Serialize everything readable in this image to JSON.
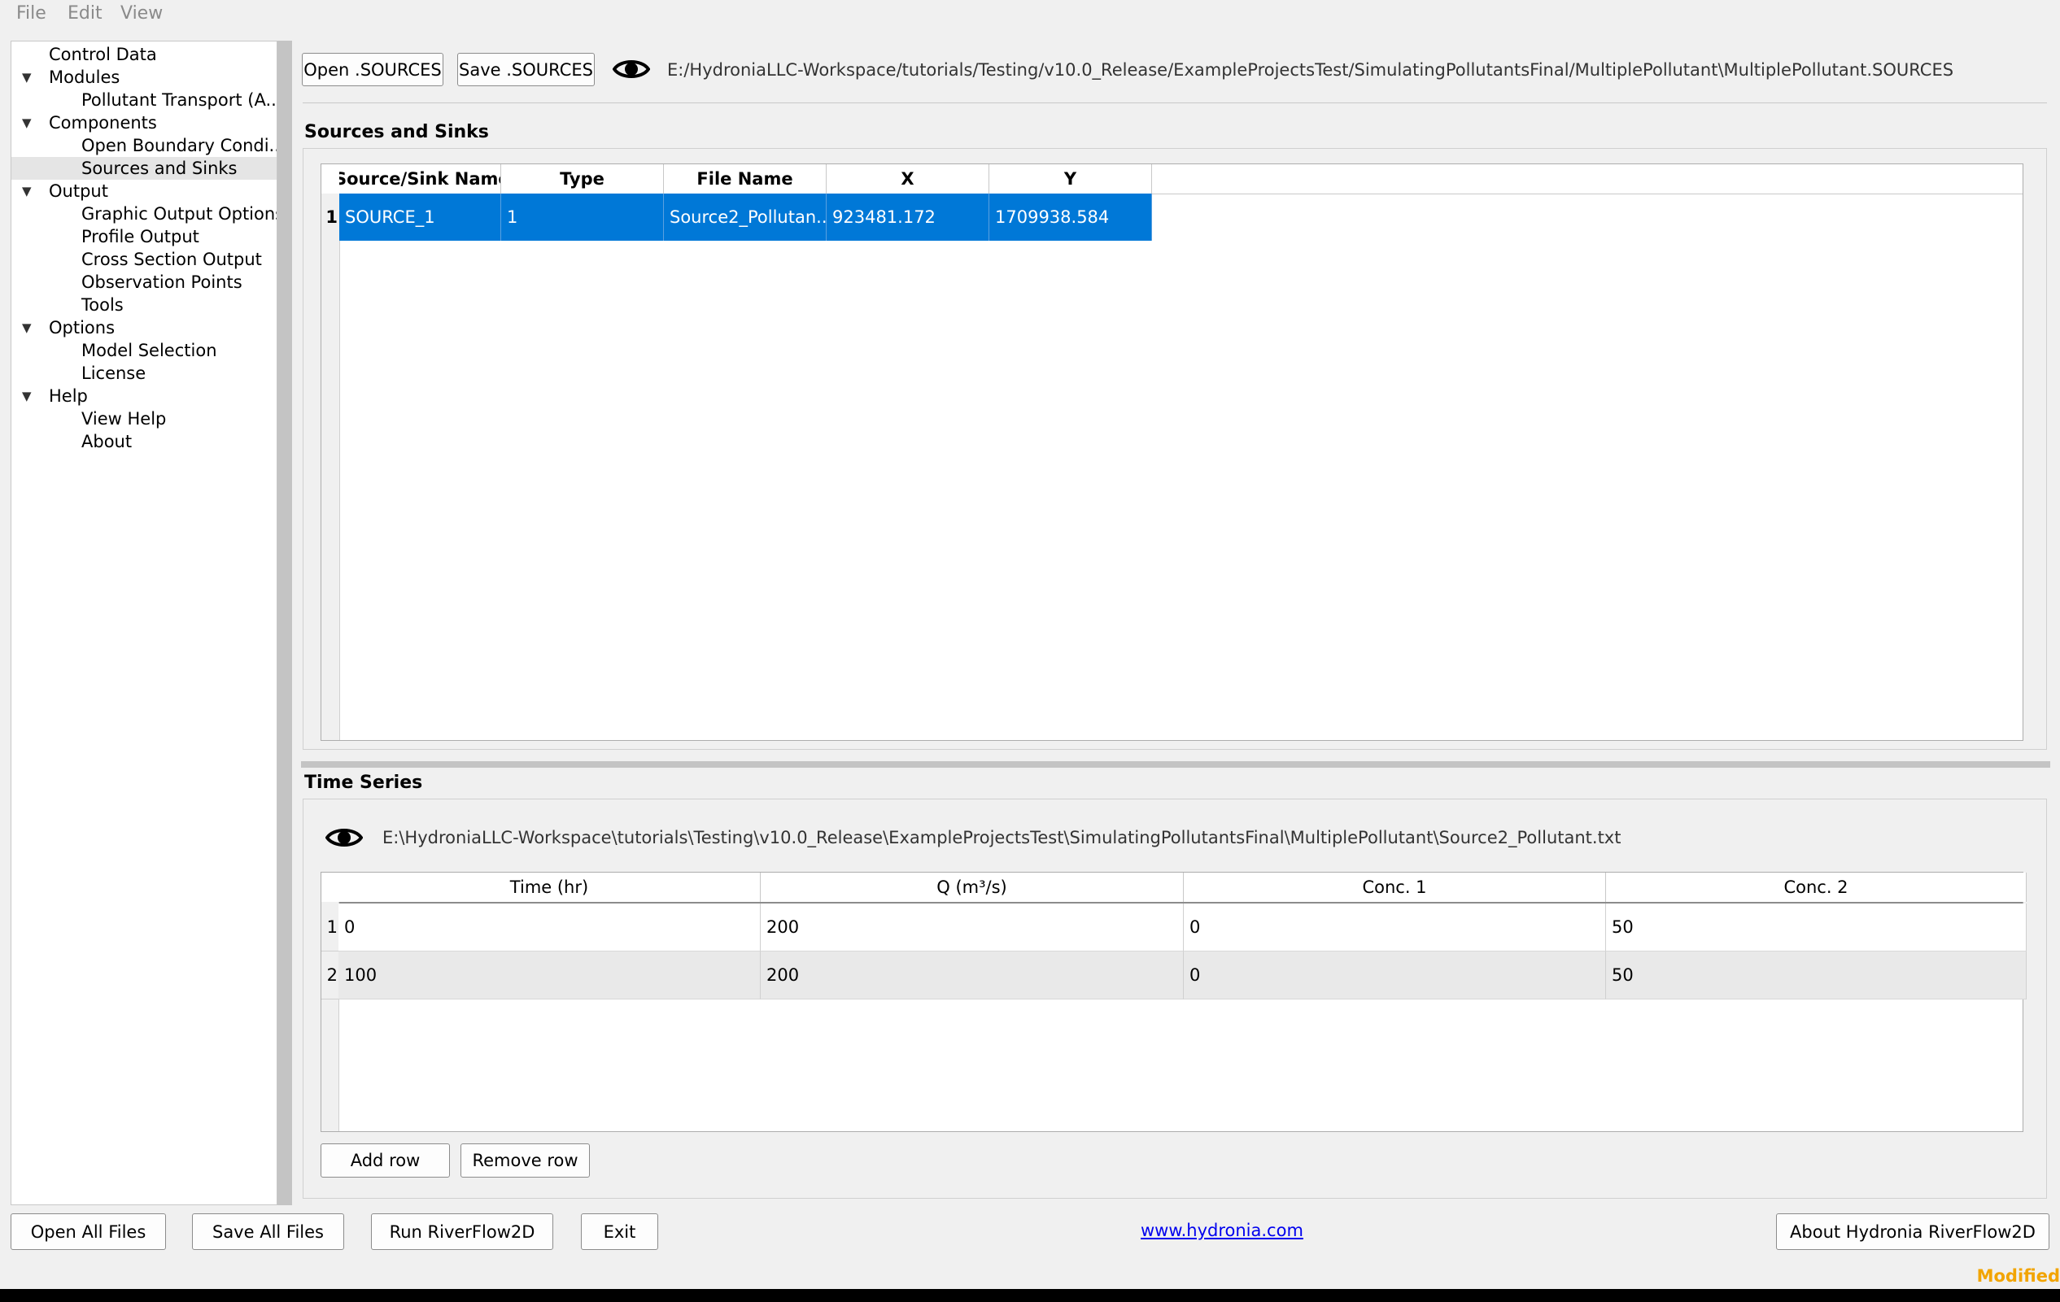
{
  "menu": {
    "file": "File",
    "edit": "Edit",
    "view": "View"
  },
  "tree": {
    "items": [
      {
        "label": "Control Data",
        "level": 0,
        "expander": false
      },
      {
        "label": "Modules",
        "level": 0,
        "expander": true
      },
      {
        "label": "Pollutant Transport (A...",
        "level": 1,
        "expander": false
      },
      {
        "label": "Components",
        "level": 0,
        "expander": true
      },
      {
        "label": "Open Boundary Condi...",
        "level": 1,
        "expander": false
      },
      {
        "label": "Sources and Sinks",
        "level": 1,
        "expander": false,
        "selected": true
      },
      {
        "label": "Output",
        "level": 0,
        "expander": true
      },
      {
        "label": "Graphic Output Options",
        "level": 1,
        "expander": false
      },
      {
        "label": "Profile Output",
        "level": 1,
        "expander": false
      },
      {
        "label": "Cross Section Output",
        "level": 1,
        "expander": false
      },
      {
        "label": "Observation Points",
        "level": 1,
        "expander": false
      },
      {
        "label": "Tools",
        "level": 1,
        "expander": false
      },
      {
        "label": "Options",
        "level": 0,
        "expander": true
      },
      {
        "label": "Model Selection",
        "level": 1,
        "expander": false
      },
      {
        "label": "License",
        "level": 1,
        "expander": false
      },
      {
        "label": "Help",
        "level": 0,
        "expander": true
      },
      {
        "label": "View Help",
        "level": 1,
        "expander": false
      },
      {
        "label": "About",
        "level": 1,
        "expander": false
      }
    ],
    "expander_icon": "triangle-down-icon"
  },
  "toolbar": {
    "open_label": "Open .SOURCES",
    "save_label": "Save .SOURCES",
    "eye_icon": "eye-icon",
    "path": "E:/HydroniaLLC-Workspace/tutorials/Testing/v10.0_Release/ExampleProjectsTest/SimulatingPollutantsFinal/MultiplePollutant\\MultiplePollutant.SOURCES"
  },
  "sources": {
    "title": "Sources and Sinks",
    "columns": [
      "Source/Sink Name",
      "Type",
      "File Name",
      "X",
      "Y"
    ],
    "rows": [
      {
        "num": "1",
        "cells": [
          "SOURCE_1",
          "1",
          "Source2_Pollutan...",
          "923481.172",
          "1709938.584"
        ]
      }
    ]
  },
  "timeseries": {
    "title": "Time Series",
    "path": "E:\\HydroniaLLC-Workspace\\tutorials\\Testing\\v10.0_Release\\ExampleProjectsTest\\SimulatingPollutantsFinal\\MultiplePollutant\\Source2_Pollutant.txt",
    "columns": [
      "Time (hr)",
      "Q (m³/s)",
      "Conc. 1",
      "Conc. 2"
    ],
    "rows": [
      {
        "num": "1",
        "cells": [
          "0",
          "200",
          "0",
          "50"
        ]
      },
      {
        "num": "2",
        "cells": [
          "100",
          "200",
          "0",
          "50"
        ]
      }
    ],
    "add_row": "Add row",
    "remove_row": "Remove row"
  },
  "footer": {
    "open_all": "Open All Files",
    "save_all": "Save All Files",
    "run": "Run RiverFlow2D",
    "exit": "Exit",
    "link": "www.hydronia.com",
    "about": "About Hydronia RiverFlow2D",
    "status": "Modified"
  },
  "colors": {
    "selection": "#0078d7",
    "status": "#f2a400",
    "link": "#0000ee"
  }
}
